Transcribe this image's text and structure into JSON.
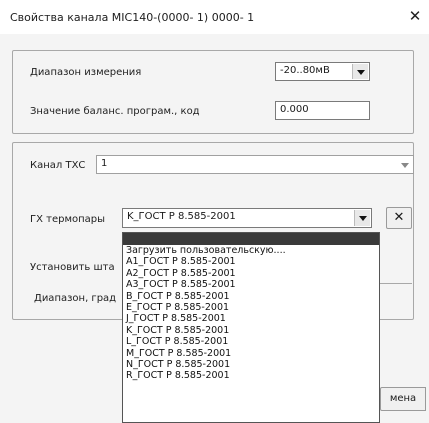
{
  "window": {
    "title": "Свойства канала MIC140-(0000- 1) 0000- 1",
    "close_glyph": "✕"
  },
  "range_group": {
    "measure_range_label": "Диапазон измерения",
    "measure_range_value": "-20..80мВ",
    "balance_label": "Значение баланс. програм., код",
    "balance_value": "0.000"
  },
  "txc_group": {
    "channel_label": "Канал ТХС",
    "channel_value": "1"
  },
  "thermo": {
    "label": "ГХ термопары",
    "value": "K_ГОСТ Р 8.585-2001",
    "clear_label": "✕",
    "set_label": "Установить шта",
    "range_label": "Диапазон, град",
    "cancel_label": "мена"
  },
  "dropdown": {
    "options": [
      "Загрузить пользовательскую....",
      "A1_ГОСТ Р 8.585-2001",
      "A2_ГОСТ Р 8.585-2001",
      "A3_ГОСТ Р 8.585-2001",
      "B_ГОСТ Р 8.585-2001",
      "E_ГОСТ Р 8.585-2001",
      "J_ГОСТ Р 8.585-2001",
      "K_ГОСТ Р 8.585-2001",
      "L_ГОСТ Р 8.585-2001",
      "M_ГОСТ Р 8.585-2001",
      "N_ГОСТ Р 8.585-2001",
      "R_ГОСТ Р 8.585-2001"
    ]
  }
}
